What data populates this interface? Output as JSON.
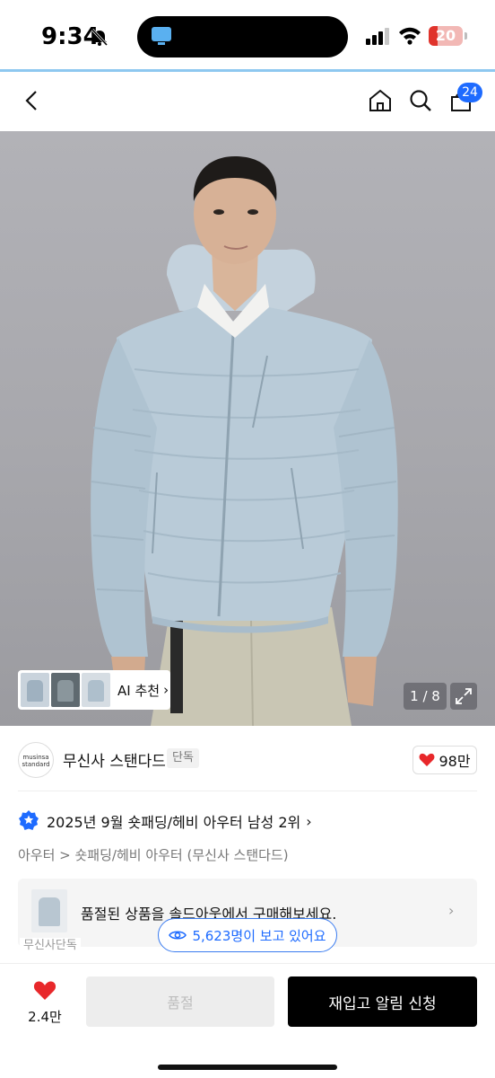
{
  "status_bar": {
    "time": "9:34",
    "battery": "20",
    "icons": [
      "bell-off-icon",
      "screen-mirroring-icon",
      "signal-icon",
      "wifi-icon",
      "battery-icon"
    ]
  },
  "nav": {
    "icons": [
      "back-icon",
      "home-icon",
      "search-icon",
      "cart-icon"
    ],
    "cart_count": "24"
  },
  "hero": {
    "ai_recommend_label": "AI 추천",
    "pager": "1 / 8",
    "icons": [
      "chevron-right-icon",
      "expand-icon"
    ]
  },
  "brand": {
    "logo_line1": "musinsa",
    "logo_line2": "standard",
    "name": "무신사 스탠다드",
    "tag": "단독",
    "like_count": "98만"
  },
  "ranking": {
    "text": "2025년 9월 숏패딩/헤비 아우터 남성 2위"
  },
  "breadcrumb": "아우터 > 숏패딩/헤비 아우터 (무신사 스탠다드)",
  "soldout_card": {
    "text": "품절된 상품을 솔드아웃에서 구매해보세요."
  },
  "partial_text": "무신사단독",
  "viewers": "5,623명이 보고 있어요",
  "bottom_bar": {
    "wish_count": "2.4만",
    "soldout_label": "품절",
    "restock_label": "재입고 알림 신청"
  },
  "colors": {
    "accent_blue": "#1e6bff",
    "heart_red": "#e8282b",
    "jacket": "#b9cbd8",
    "battery_red": "#e0342c"
  }
}
